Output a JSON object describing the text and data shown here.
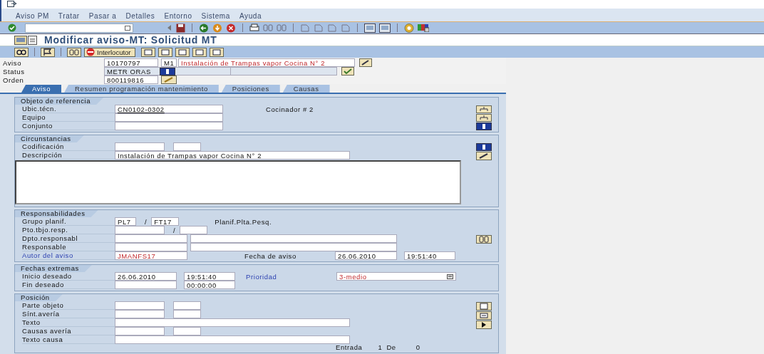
{
  "menu": [
    "Aviso PM",
    "Tratar",
    "Pasar a",
    "Detalles",
    "Entorno",
    "Sistema",
    "Ayuda"
  ],
  "title": "Modificar aviso-MT: Solicitud MT",
  "partner_button": "Interlocutor",
  "header": {
    "aviso_label": "Aviso",
    "aviso": "10170797",
    "clase": "M1",
    "descripcion": "Instalación de Trampas vapor Cocina N° 2",
    "status_label": "Status",
    "status": "METR ORAS",
    "orden_label": "Orden",
    "orden": "800119816"
  },
  "tabs": [
    {
      "label": "Aviso",
      "selected": true
    },
    {
      "label": "Resumen programación mantenimiento",
      "selected": false
    },
    {
      "label": "Posiciones",
      "selected": false
    },
    {
      "label": "Causas",
      "selected": false
    }
  ],
  "sections": [
    {
      "title": "Objeto de referencia",
      "rows": [
        {
          "label": "Ubic.técn.",
          "items": [
            {
              "kind": "object",
              "value": "CN0102-0302"
            },
            {
              "kind": "note",
              "text": "Cocinador # 2"
            }
          ]
        },
        {
          "label": "Equipo",
          "items": [
            {
              "kind": "object"
            }
          ]
        },
        {
          "label": "Conjunto",
          "items": [
            {
              "kind": "object"
            }
          ]
        }
      ]
    },
    {
      "title": "Circunstancias",
      "rows": [
        {
          "label": "Codificación",
          "items": [
            {
              "kind": "code"
            },
            {
              "kind": "subcode"
            }
          ]
        },
        {
          "label": "Descripción",
          "items": [
            {
              "kind": "text",
              "value": "Instalación de Trampas vapor Cocina N° 2"
            }
          ]
        },
        {
          "items": [
            {
              "kind": "area"
            }
          ]
        }
      ]
    },
    {
      "title": "Responsabilidades",
      "rows": [
        {
          "label": "Grupo planif.",
          "items": [
            {
              "kind": "short",
              "value": "PL7"
            },
            {
              "kind": "sep",
              "text": "/"
            },
            {
              "kind": "subcode",
              "value": "FT17"
            },
            {
              "kind": "note",
              "text": "Planif.Plta.Pesq."
            }
          ]
        },
        {
          "label": "Pto.tbjo.resp.",
          "items": [
            {
              "kind": "code"
            },
            {
              "kind": "sep",
              "text": "/"
            },
            {
              "kind": "subcode"
            }
          ]
        },
        {
          "label": "Dpto.responsabl",
          "items": [
            {
              "kind": "unit"
            },
            {
              "kind": "name"
            }
          ]
        },
        {
          "label": "Responsable",
          "items": [
            {
              "kind": "unit"
            },
            {
              "kind": "name"
            }
          ]
        },
        {
          "label": "Autor del aviso",
          "link": true,
          "items": [
            {
              "kind": "unit",
              "value": "JMANFS17",
              "attention": true
            },
            {
              "kind": "caption",
              "text": "Fecha de aviso"
            },
            {
              "kind": "date",
              "value": "26.06.2010"
            },
            {
              "kind": "time",
              "value": "19:51:40"
            }
          ]
        }
      ]
    },
    {
      "title": "Fechas extremas",
      "rows": [
        {
          "label": "Inicio deseado",
          "items": [
            {
              "kind": "date",
              "value": "26.06.2010"
            },
            {
              "kind": "time",
              "value": "19:51:40"
            },
            {
              "kind": "caption",
              "text": "Prioridad",
              "link": true
            },
            {
              "kind": "priority",
              "value": "3-medio",
              "attention": true
            }
          ]
        },
        {
          "label": "Fin deseado",
          "items": [
            {
              "kind": "date"
            },
            {
              "kind": "time",
              "value": "00:00:00"
            }
          ]
        }
      ]
    },
    {
      "title": "Posición",
      "rows": [
        {
          "label": "Parte objeto",
          "items": [
            {
              "kind": "code"
            },
            {
              "kind": "subcode"
            }
          ]
        },
        {
          "label": "Sínt.avería",
          "items": [
            {
              "kind": "code"
            },
            {
              "kind": "subcode"
            }
          ]
        },
        {
          "label": "Texto",
          "items": [
            {
              "kind": "text"
            }
          ]
        },
        {
          "label": "Causas avería",
          "items": [
            {
              "kind": "code"
            },
            {
              "kind": "subcode"
            }
          ]
        },
        {
          "label": "Texto causa",
          "items": [
            {
              "kind": "text"
            }
          ]
        }
      ],
      "footer": [
        "Entrada",
        "1",
        "De",
        "0"
      ]
    }
  ]
}
